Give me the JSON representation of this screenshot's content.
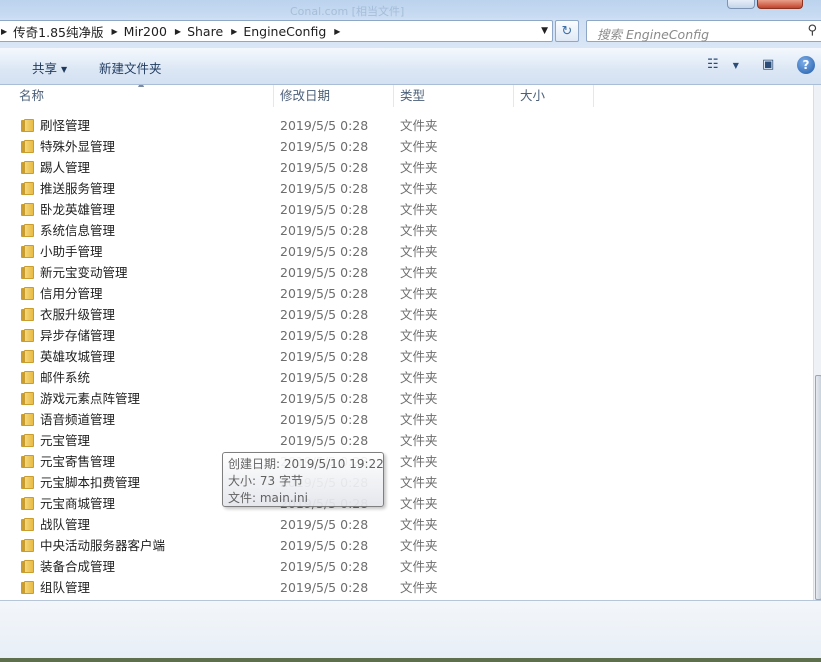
{
  "window": {
    "ghost_title": "Conal.com [相当文件]"
  },
  "address": {
    "breadcrumbs": [
      "传奇1.85纯净版",
      "Mir200",
      "Share",
      "EngineConfig"
    ]
  },
  "search": {
    "placeholder": "搜索 EngineConfig"
  },
  "toolbar": {
    "share_label": "共享",
    "new_folder_label": "新建文件夹"
  },
  "columns": {
    "name": "名称",
    "modified": "修改日期",
    "type": "类型",
    "size": "大小"
  },
  "files": [
    {
      "name": "刷怪管理",
      "modified": "2019/5/5 0:28",
      "type": "文件夹"
    },
    {
      "name": "特殊外显管理",
      "modified": "2019/5/5 0:28",
      "type": "文件夹"
    },
    {
      "name": "踢人管理",
      "modified": "2019/5/5 0:28",
      "type": "文件夹"
    },
    {
      "name": "推送服务管理",
      "modified": "2019/5/5 0:28",
      "type": "文件夹"
    },
    {
      "name": "卧龙英雄管理",
      "modified": "2019/5/5 0:28",
      "type": "文件夹"
    },
    {
      "name": "系统信息管理",
      "modified": "2019/5/5 0:28",
      "type": "文件夹"
    },
    {
      "name": "小助手管理",
      "modified": "2019/5/5 0:28",
      "type": "文件夹"
    },
    {
      "name": "新元宝变动管理",
      "modified": "2019/5/5 0:28",
      "type": "文件夹"
    },
    {
      "name": "信用分管理",
      "modified": "2019/5/5 0:28",
      "type": "文件夹"
    },
    {
      "name": "衣服升级管理",
      "modified": "2019/5/5 0:28",
      "type": "文件夹"
    },
    {
      "name": "异步存储管理",
      "modified": "2019/5/5 0:28",
      "type": "文件夹"
    },
    {
      "name": "英雄攻城管理",
      "modified": "2019/5/5 0:28",
      "type": "文件夹"
    },
    {
      "name": "邮件系统",
      "modified": "2019/5/5 0:28",
      "type": "文件夹"
    },
    {
      "name": "游戏元素点阵管理",
      "modified": "2019/5/5 0:28",
      "type": "文件夹"
    },
    {
      "name": "语音频道管理",
      "modified": "2019/5/5 0:28",
      "type": "文件夹"
    },
    {
      "name": "元宝管理",
      "modified": "2019/5/5 0:28",
      "type": "文件夹"
    },
    {
      "name": "元宝寄售管理",
      "modified": "2019/5/5 0:28",
      "type": "文件夹"
    },
    {
      "name": "元宝脚本扣费管理",
      "modified": "2019/5/5 0:28",
      "type": "文件夹"
    },
    {
      "name": "元宝商城管理",
      "modified": "2019/5/5 0:28",
      "type": "文件夹"
    },
    {
      "name": "战队管理",
      "modified": "2019/5/5 0:28",
      "type": "文件夹"
    },
    {
      "name": "中央活动服务器客户端",
      "modified": "2019/5/5 0:28",
      "type": "文件夹"
    },
    {
      "name": "装备合成管理",
      "modified": "2019/5/5 0:28",
      "type": "文件夹"
    },
    {
      "name": "组队管理",
      "modified": "2019/5/5 0:28",
      "type": "文件夹"
    }
  ],
  "tooltip": {
    "created": "创建日期: 2019/5/10 19:22",
    "size": "大小: 73 字节",
    "file": "文件: main.ini"
  }
}
